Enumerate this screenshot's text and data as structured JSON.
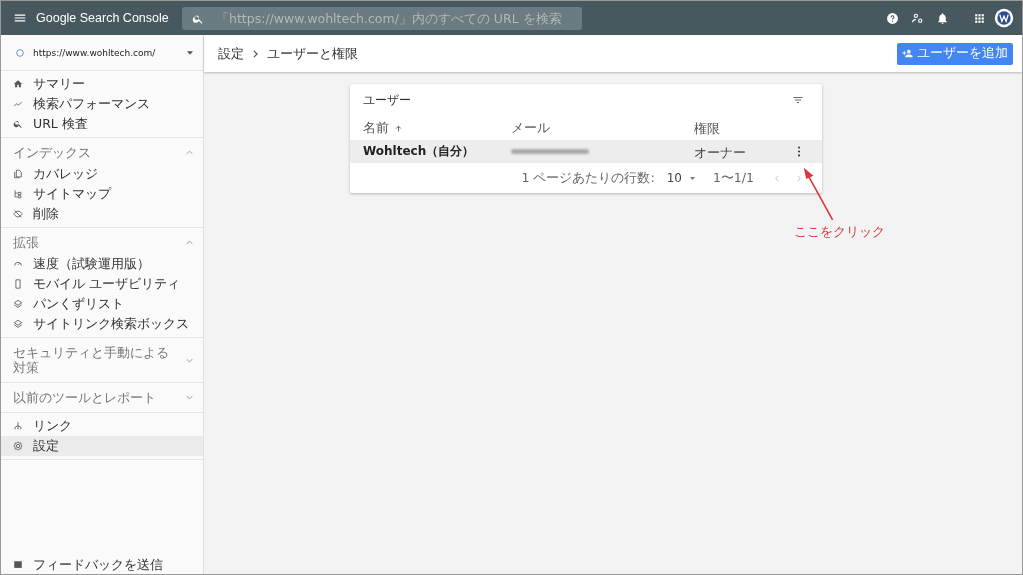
{
  "header": {
    "product": "Google Search Console",
    "search": {
      "placeholder": "「https://www.wohltech.com/」内のすべての URL を検索"
    }
  },
  "sidebar": {
    "property": "https://www.wohltech.com/",
    "groups": [
      {
        "items": [
          {
            "label": "サマリー",
            "selected": false
          },
          {
            "label": "検索パフォーマンス",
            "selected": false
          },
          {
            "label": "URL 検査",
            "selected": false
          }
        ]
      },
      {
        "title": "インデックス",
        "expanded": true,
        "items": [
          {
            "label": "カバレッジ",
            "selected": false
          },
          {
            "label": "サイトマップ",
            "selected": false
          },
          {
            "label": "削除",
            "selected": false
          }
        ]
      },
      {
        "title": "拡張",
        "expanded": true,
        "items": [
          {
            "label": "速度（試験運用版）",
            "selected": false
          },
          {
            "label": "モバイル ユーザビリティ",
            "selected": false
          },
          {
            "label": "パンくずリスト",
            "selected": false
          },
          {
            "label": "サイトリンク検索ボックス",
            "selected": false
          }
        ]
      },
      {
        "title": "セキュリティと手動による対策",
        "expanded": false
      },
      {
        "title": "以前のツールとレポート",
        "expanded": false
      },
      {
        "items": [
          {
            "label": "リンク",
            "selected": false
          },
          {
            "label": "設定",
            "selected": true
          }
        ]
      }
    ],
    "feedback": "フィードバックを送信"
  },
  "breadcrumb": [
    "設定",
    "ユーザーと権限"
  ],
  "add_user_button": "ユーザーを追加",
  "card": {
    "title": "ユーザー",
    "columns": [
      "名前",
      "メール",
      "権限"
    ],
    "rows": [
      {
        "name": "Wohltech（自分）",
        "role": "オーナー"
      }
    ],
    "footer": {
      "rows_per_page_label": "1 ページあたりの行数:",
      "rows_per_page": "10",
      "range": "1〜1/1"
    }
  },
  "annotation": "ここをクリック"
}
